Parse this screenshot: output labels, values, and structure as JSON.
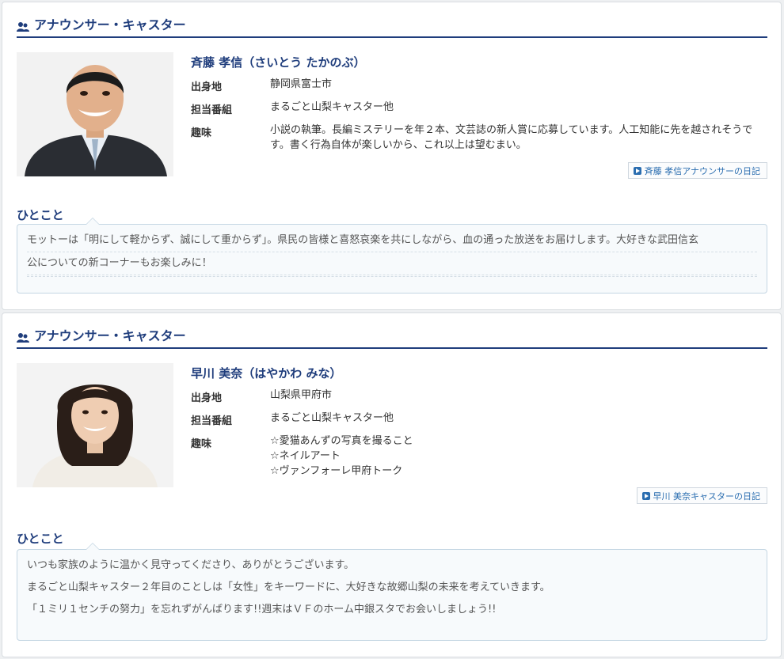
{
  "profiles": [
    {
      "section_title": "アナウンサー・キャスター",
      "name": "斉藤 孝信（さいとう たかのぶ）",
      "fields": [
        {
          "label": "出身地",
          "value": "静岡県富士市"
        },
        {
          "label": "担当番組",
          "value": "まるごと山梨キャスター他"
        },
        {
          "label": "趣味",
          "value": "小説の執筆。長編ミステリーを年２本、文芸誌の新人賞に応募しています。人工知能に先を越されそうです。書く行為自体が楽しいから、これ以上は望むまい。"
        }
      ],
      "diary_label": "斉藤 孝信アナウンサーの日記",
      "hitokoto_title": "ひとこと",
      "hitokoto_lines": [
        "モットーは「明にして軽からず、誠にして重からず」。県民の皆様と喜怒哀楽を共にしながら、血の通った放送をお届けします。大好きな武田信玄",
        "公についての新コーナーもお楽しみに！",
        ""
      ]
    },
    {
      "section_title": "アナウンサー・キャスター",
      "name": "早川 美奈（はやかわ みな）",
      "fields": [
        {
          "label": "出身地",
          "value": "山梨県甲府市"
        },
        {
          "label": "担当番組",
          "value": "まるごと山梨キャスター他"
        },
        {
          "label": "趣味",
          "value_lines": [
            "☆愛猫あんずの写真を撮ること",
            "☆ネイルアート",
            "☆ヴァンフォーレ甲府トーク"
          ]
        }
      ],
      "diary_label": "早川 美奈キャスターの日記",
      "hitokoto_title": "ひとこと",
      "hitokoto_lines": [
        "いつも家族のように温かく見守ってくださり、ありがとうございます。",
        "まるごと山梨キャスター２年目のことしは「女性」をキーワードに、大好きな故郷山梨の未来を考えていきます。",
        "「１ミリ１センチの努力」を忘れずがんばります!!週末はＶＦのホーム中銀スタでお会いしましょう!!"
      ]
    }
  ],
  "colors": {
    "accent": "#1f3d7c",
    "link": "#2a6db0"
  },
  "icons": {
    "section": "people-icon",
    "diary": "play-icon"
  }
}
